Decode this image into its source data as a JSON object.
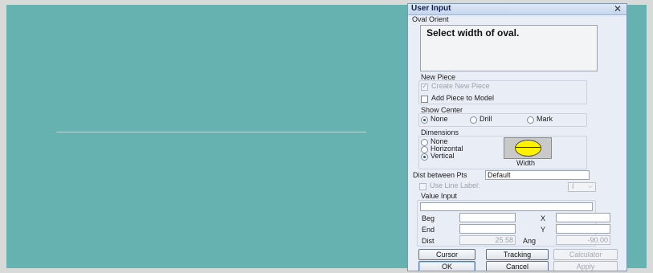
{
  "dialog": {
    "title": "User Input",
    "prompt_label": "Oval Orient",
    "prompt_text": "Select width of oval."
  },
  "new_piece": {
    "title": "New Piece",
    "create_label": "Create New Piece",
    "create_checked": true,
    "add_label": "Add Piece to Model",
    "add_checked": false
  },
  "show_center": {
    "title": "Show Center",
    "options": [
      "None",
      "Drill",
      "Mark"
    ],
    "selected": "None"
  },
  "dimensions": {
    "title": "Dimensions",
    "options": [
      "None",
      "Horizontal",
      "Vertical"
    ],
    "selected": "Vertical",
    "preview_caption": "Width"
  },
  "dist_between": {
    "label": "Dist between Pts",
    "value": "Default"
  },
  "line_label": {
    "label": "Use Line Label:",
    "dropdown_value": "I",
    "checked": false
  },
  "value_input": {
    "title": "Value Input",
    "beg_label": "Beg",
    "end_label": "End",
    "dist_label": "Dist",
    "dist_value": "25.58",
    "x_label": "X",
    "y_label": "Y",
    "ang_label": "Ang",
    "ang_value": "-90.00"
  },
  "buttons": {
    "cursor": "Cursor",
    "tracking": "Tracking",
    "calculator": "Calculator",
    "ok": "OK",
    "cancel": "Cancel",
    "apply": "Apply"
  },
  "colors": {
    "canvas": "#66b2b0",
    "panel": "#e9eef6",
    "oval_fill": "#fff200",
    "radio_selected": "#1d4fa0"
  }
}
